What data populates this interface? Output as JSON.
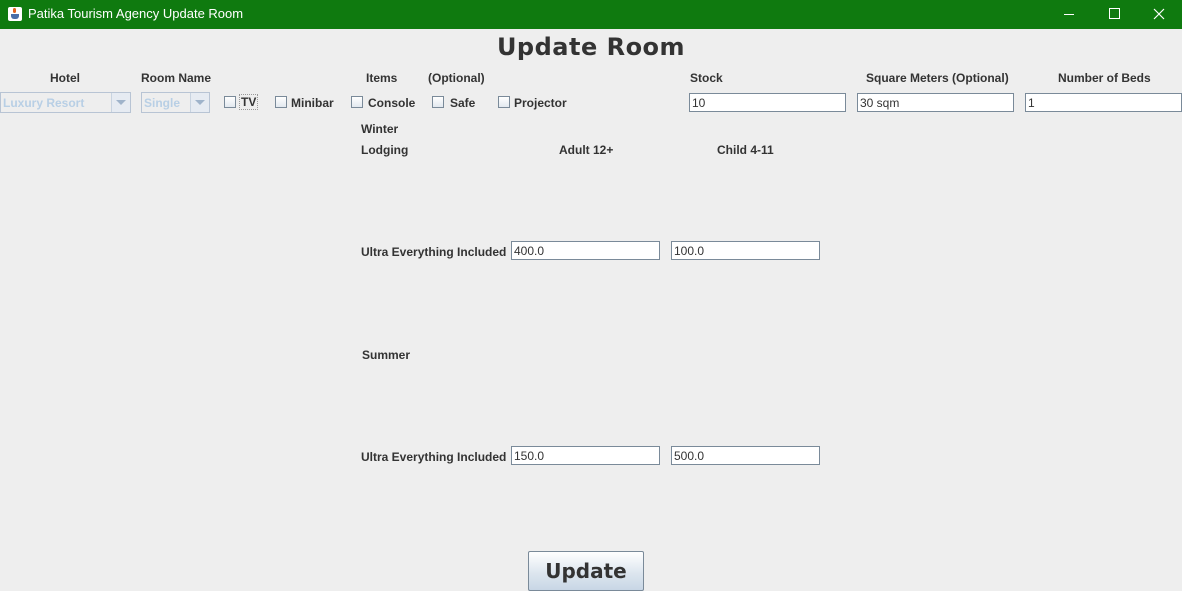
{
  "window": {
    "title": "Patika Tourism Agency Update Room",
    "titlebar_color": "#0f7a0f",
    "icons": [
      "java-cup-icon",
      "minimize-icon",
      "maximize-icon",
      "close-icon"
    ]
  },
  "page": {
    "heading": "Update Room"
  },
  "hotel": {
    "label": "Hotel",
    "selected": "Luxury Resort"
  },
  "room_name": {
    "label": "Room Name",
    "selected": "Single"
  },
  "items": {
    "label": "Items",
    "optional_label": "(Optional)",
    "options": [
      {
        "label": "TV",
        "checked": false
      },
      {
        "label": "Minibar",
        "checked": false
      },
      {
        "label": "Console",
        "checked": false
      },
      {
        "label": "Safe",
        "checked": false
      },
      {
        "label": "Projector",
        "checked": false
      }
    ]
  },
  "stock": {
    "label": "Stock",
    "value": "10"
  },
  "square_meters": {
    "label": "Square Meters (Optional)",
    "value": "30 sqm"
  },
  "beds": {
    "label": "Number of Beds",
    "value": "1"
  },
  "pricing": {
    "lodging_header": "Lodging",
    "adult_header": "Adult 12+",
    "child_header": "Child 4-11",
    "winter": {
      "season": "Winter",
      "rows": [
        {
          "lodging": "Ultra Everything Included",
          "adult": "400.0",
          "child": "100.0"
        }
      ]
    },
    "summer": {
      "season": "Summer",
      "rows": [
        {
          "lodging": "Ultra Everything Included",
          "adult": "150.0",
          "child": "500.0"
        }
      ]
    }
  },
  "actions": {
    "update_label": "Update"
  }
}
